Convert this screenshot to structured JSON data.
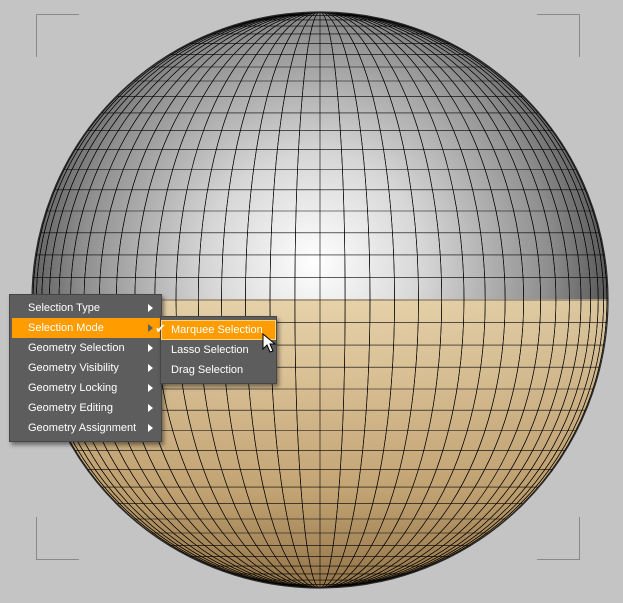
{
  "viewport": {
    "background": "#c4c4c4",
    "object": "sphere",
    "colors": {
      "selected": "#e5c593",
      "unselected": "#ffffff",
      "wire": "#000000"
    }
  },
  "context_menu": {
    "items": [
      {
        "label": "Selection Type",
        "has_submenu": true,
        "active": false
      },
      {
        "label": "Selection Mode",
        "has_submenu": true,
        "active": true
      },
      {
        "label": "Geometry Selection",
        "has_submenu": true,
        "active": false
      },
      {
        "label": "Geometry Visibility",
        "has_submenu": true,
        "active": false
      },
      {
        "label": "Geometry Locking",
        "has_submenu": true,
        "active": false
      },
      {
        "label": "Geometry Editing",
        "has_submenu": true,
        "active": false
      },
      {
        "label": "Geometry Assignment",
        "has_submenu": true,
        "active": false
      }
    ],
    "accent": "#ff9c00"
  },
  "selection_mode_submenu": {
    "items": [
      {
        "label": "Marquee Selection",
        "checked": true
      },
      {
        "label": "Lasso Selection",
        "checked": false
      },
      {
        "label": "Drag Selection",
        "checked": false
      }
    ]
  }
}
